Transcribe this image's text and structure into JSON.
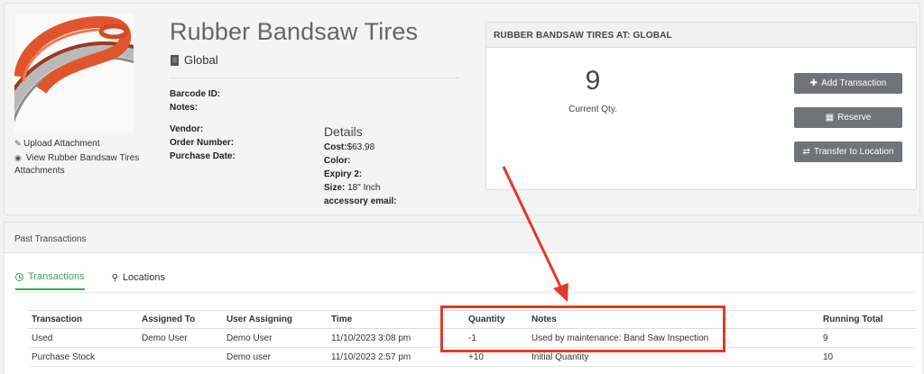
{
  "item": {
    "title": "Rubber Bandsaw Tires",
    "location": "Global",
    "image_icon": "bandsaw-tire-photo",
    "links": {
      "upload": "Upload Attachment",
      "view": "View Rubber Bandsaw Tires Attachments"
    },
    "fields_a": [
      {
        "label": "Barcode ID:",
        "value": ""
      },
      {
        "label": "Notes:",
        "value": ""
      }
    ],
    "fields_b": [
      {
        "label": "Vendor:",
        "value": ""
      },
      {
        "label": "Order Number:",
        "value": ""
      },
      {
        "label": "Purchase Date:",
        "value": ""
      }
    ],
    "details": {
      "heading": "Details",
      "rows": [
        {
          "label": "Cost:",
          "value": "$63.98"
        },
        {
          "label": "Color:",
          "value": ""
        },
        {
          "label": "Expiry 2:",
          "value": ""
        },
        {
          "label": "Size:",
          "value": " 18\" Inch"
        },
        {
          "label": "accessory email:",
          "value": ""
        }
      ]
    }
  },
  "location_panel": {
    "header": "RUBBER BANDSAW TIRES AT: GLOBAL",
    "qty": "9",
    "qty_label": "Current Qty.",
    "buttons": {
      "add": "Add Transaction",
      "reserve": "Reserve",
      "transfer": "Transfer to Location"
    }
  },
  "past": {
    "header": "Past Transactions",
    "tabs": {
      "transactions": "Transactions",
      "locations": "Locations"
    },
    "columns": [
      "Transaction",
      "Assigned To",
      "User Assigning",
      "Time",
      "Quantity",
      "Notes",
      "Running Total"
    ],
    "rows": [
      [
        "Used",
        "Demo User",
        "Demo User",
        "11/10/2023 3:08 pm",
        "-1",
        "Used by maintenance: Band Saw Inspection",
        "9"
      ],
      [
        "Purchase Stock",
        "",
        "Demo user",
        "11/10/2023 2:57 pm",
        "+10",
        "Initial Quantity",
        "10"
      ]
    ]
  },
  "colors": {
    "accent": "#39a85a",
    "button": "#6f7478",
    "annotation": "#e03a2a"
  }
}
